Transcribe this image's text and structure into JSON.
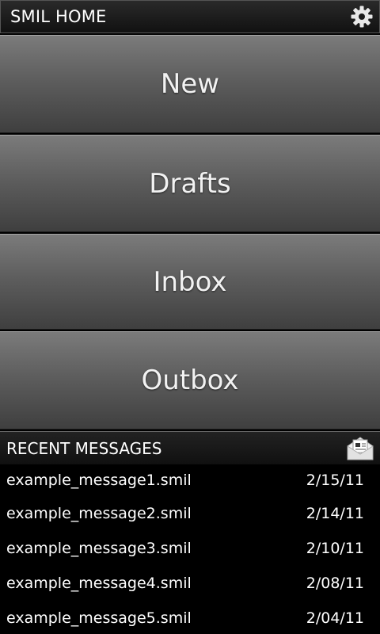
{
  "header": {
    "title": "SMIL HOME",
    "settings_icon": "gear-icon"
  },
  "menu": [
    {
      "label": "New"
    },
    {
      "label": "Drafts"
    },
    {
      "label": "Inbox"
    },
    {
      "label": "Outbox"
    }
  ],
  "recent": {
    "title": "RECENT MESSAGES",
    "icon": "open-envelope-icon",
    "messages": [
      {
        "name": "example_message1.smil",
        "date": "2/15/11"
      },
      {
        "name": "example_message2.smil",
        "date": "2/14/11"
      },
      {
        "name": "example_message3.smil",
        "date": "2/10/11"
      },
      {
        "name": "example_message4.smil",
        "date": "2/08/11"
      },
      {
        "name": "example_message5.smil",
        "date": "2/04/11"
      }
    ]
  },
  "colors": {
    "background": "#000000",
    "button_top": "#7b7b7b",
    "button_bottom": "#3f3f3f",
    "text": "#ffffff"
  }
}
